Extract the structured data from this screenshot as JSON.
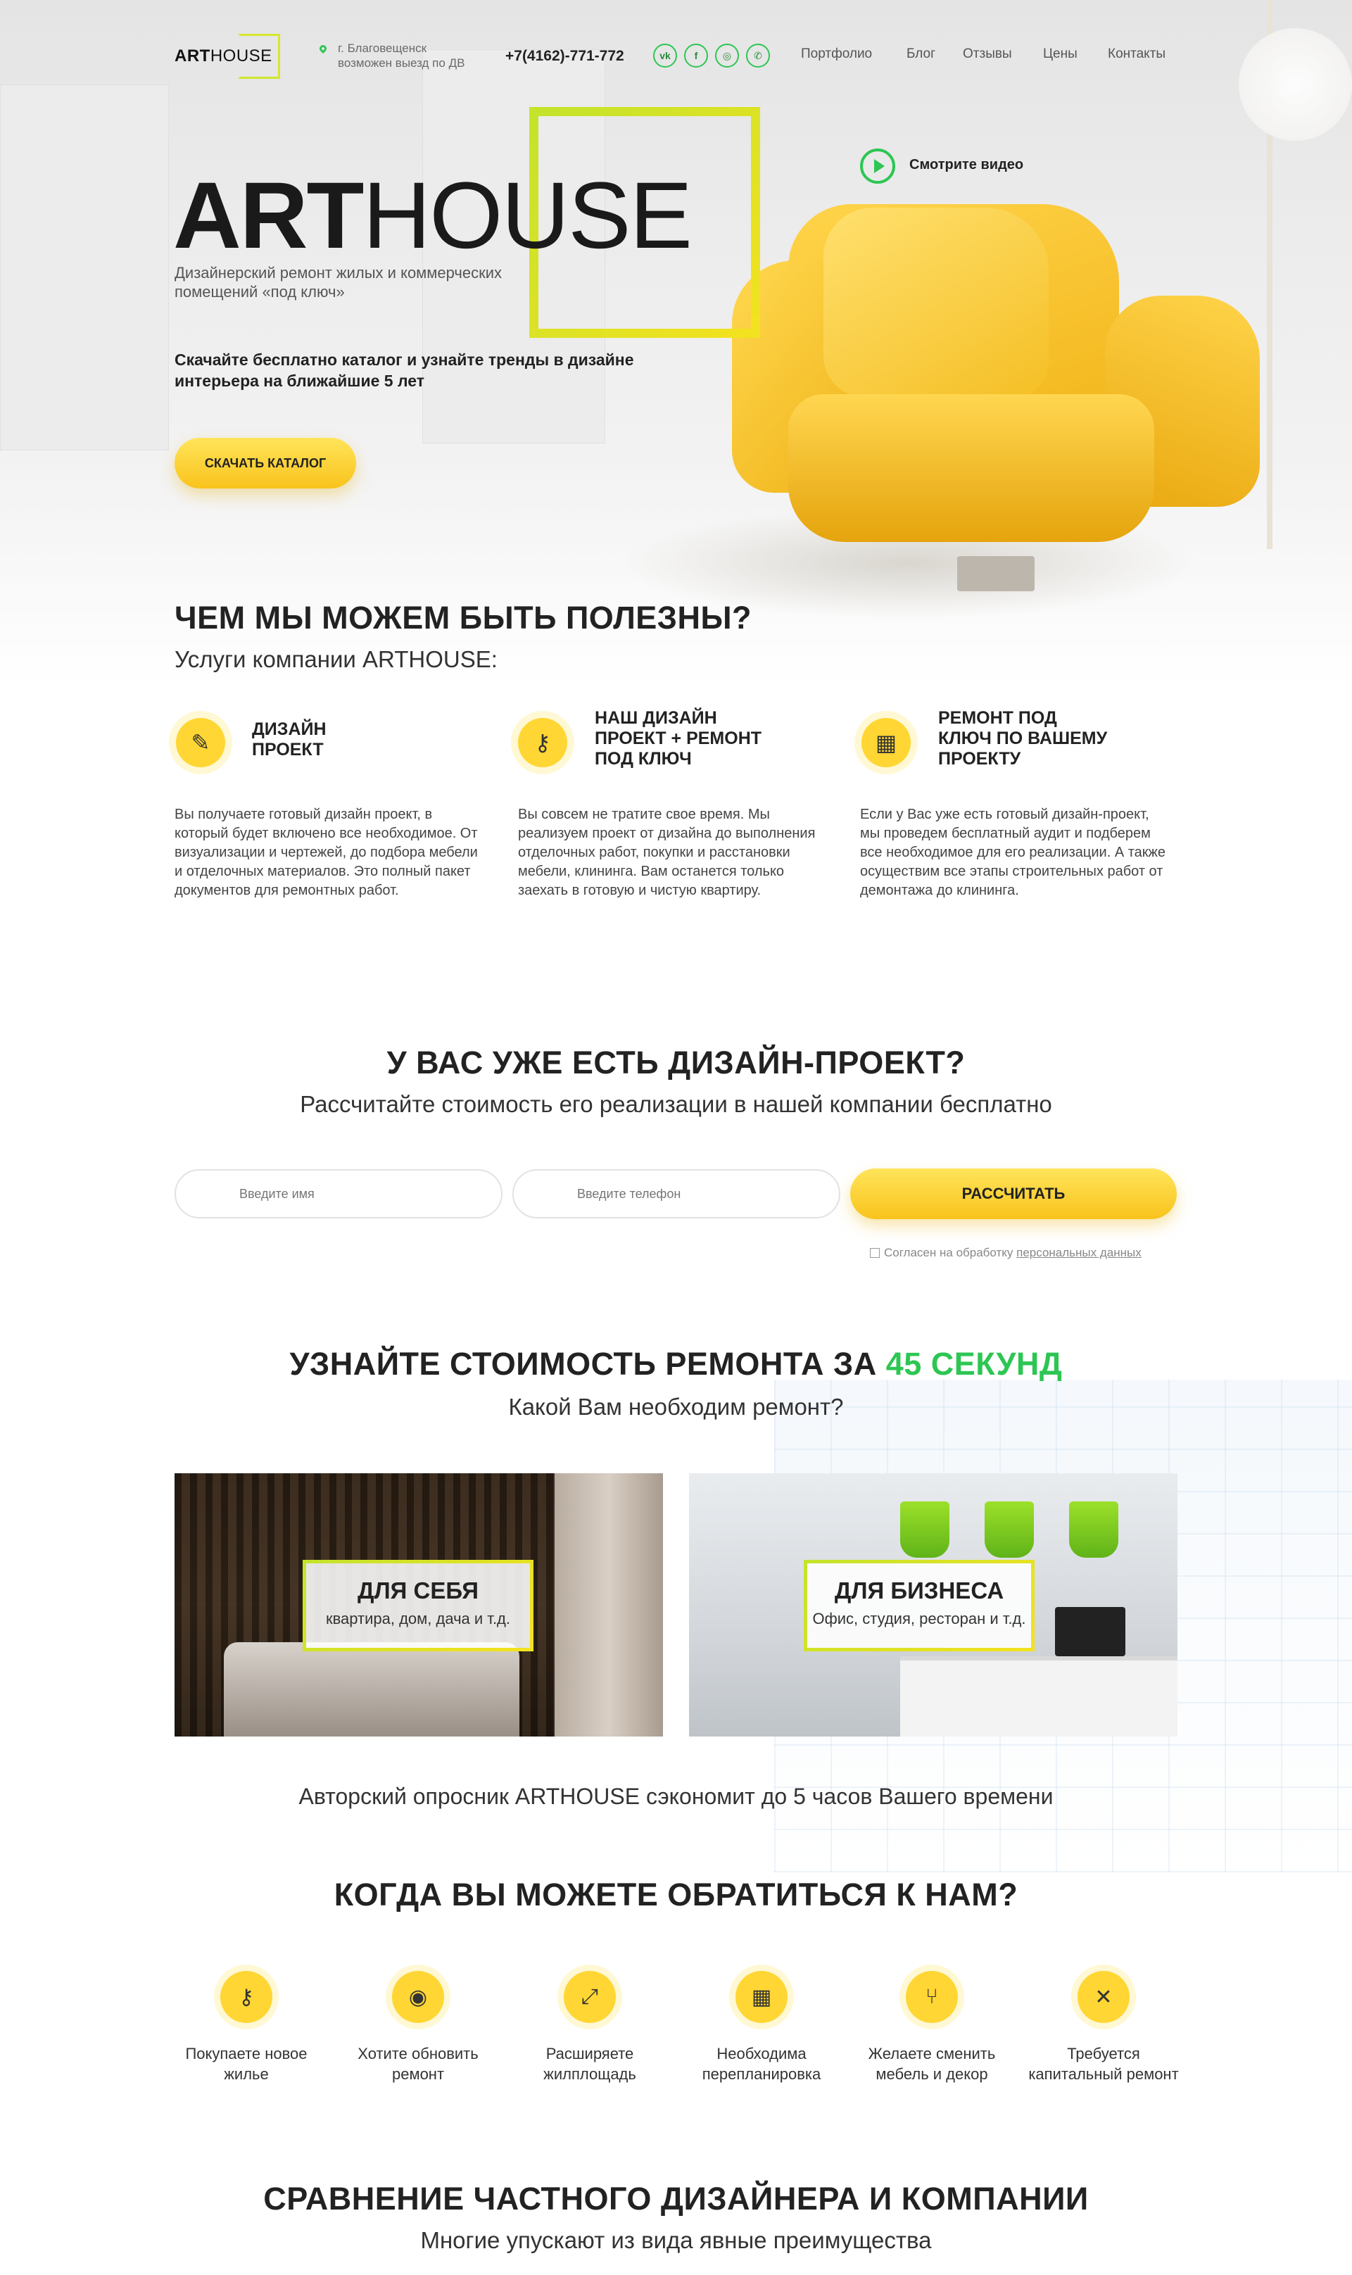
{
  "header": {
    "logo_bold": "ART",
    "logo_light": "HOUSE",
    "city_line1": "г. Благовещенск",
    "city_line2": "возможен выезд по ДВ",
    "phone": "+7(4162)-771-772",
    "social": [
      {
        "icon": "vk-icon",
        "glyph": "vk"
      },
      {
        "icon": "facebook-icon",
        "glyph": "f"
      },
      {
        "icon": "instagram-icon",
        "glyph": "◎"
      },
      {
        "icon": "whatsapp-icon",
        "glyph": "✆"
      }
    ],
    "nav": [
      "Портфолио",
      "Блог",
      "Отзывы",
      "Цены",
      "Контакты"
    ]
  },
  "hero": {
    "title_bold": "ART",
    "title_light": "HOUSE",
    "subtitle": "Дизайнерский ремонт жилых и коммерческих помещений «под ключ»",
    "description": "Скачайте бесплатно каталог и узнайте тренды в дизайне интерьера на ближайшие 5 лет",
    "button": "СКАЧАТЬ КАТАЛОГ",
    "video_label": "Смотрите видео"
  },
  "services": {
    "title": "ЧЕМ МЫ МОЖЕМ БЫТЬ ПОЛЕЗНЫ?",
    "subtitle": "Услуги компании ARTHOUSE:",
    "items": [
      {
        "icon": "design-tools-icon",
        "glyph": "✎",
        "title_lines": [
          "ДИЗАЙН",
          "ПРОЕКТ"
        ],
        "text": "Вы получаете готовый дизайн проект, в который будет включено все необходимое. От визуализации и чертежей, до подбора мебели и отделочных материалов. Это полный пакет документов для ремонтных работ."
      },
      {
        "icon": "key-icon",
        "glyph": "⚷",
        "title_lines": [
          "НАШ ДИЗАЙН",
          "ПРОЕКТ + РЕМОНТ",
          "ПОД КЛЮЧ"
        ],
        "text": "Вы совсем не тратите свое время. Мы реализуем проект от дизайна до выполнения отделочных работ, покупки и расстановки мебели, клининга. Вам останется только заехать в готовую и чистую квартиру."
      },
      {
        "icon": "floor-plan-icon",
        "glyph": "▦",
        "title_lines": [
          "РЕМОНТ ПОД",
          "КЛЮЧ ПО ВАШЕМУ",
          "ПРОЕКТУ"
        ],
        "text": "Если у Вас уже есть готовый дизайн-проект, мы проведем бесплатный аудит и подберем все необходимое для его реализации. А также осуществим все этапы строительных работ от демонтажа до клининга."
      }
    ]
  },
  "project_form": {
    "title": "У ВАС УЖЕ ЕСТЬ ДИЗАЙН-ПРОЕКТ?",
    "subtitle": "Рассчитайте стоимость его реализации в нашей компании бесплатно",
    "name_placeholder": "Введите имя",
    "phone_placeholder": "Введите телефон",
    "button": "РАССЧИТАТЬ",
    "agree_text": "Согласен на обработку",
    "agree_link": "персональных данных"
  },
  "quiz": {
    "title_main": "УЗНАЙТЕ СТОИМОСТЬ РЕМОНТА ЗА",
    "title_accent": "45 СЕКУНД",
    "subtitle": "Какой Вам необходим ремонт?",
    "cards": [
      {
        "title": "ДЛЯ СЕБЯ",
        "subtitle": "квартира, дом, дача и т.д."
      },
      {
        "title": "ДЛЯ БИЗНЕСА",
        "subtitle": "Офис, студия, ресторан и т.д."
      }
    ],
    "note": "Авторский опросник ARTHOUSE сэкономит до 5 часов Вашего времени"
  },
  "when": {
    "title": "КОГДА ВЫ МОЖЕТЕ ОБРАТИТЬСЯ К НАМ?",
    "items": [
      {
        "icon": "key-icon",
        "glyph": "⚷",
        "label": "Покупаете новое жилье"
      },
      {
        "icon": "paint-roll-icon",
        "glyph": "◉",
        "label": "Хотите обновить ремонт"
      },
      {
        "icon": "expand-arrows-icon",
        "glyph": "⤢",
        "label": "Расширяете жилплощадь"
      },
      {
        "icon": "floor-plan-icon",
        "glyph": "▦",
        "label": "Необходима перепланировка"
      },
      {
        "icon": "armchair-icon",
        "glyph": "⑂",
        "label": "Желаете сменить мебель и декор"
      },
      {
        "icon": "tools-icon",
        "glyph": "✕",
        "label": "Требуется капитальный ремонт"
      }
    ]
  },
  "compare": {
    "title": "СРАВНЕНИЕ ЧАСТНОГО ДИЗАЙНЕРА И КОМПАНИИ",
    "subtitle": "Многие упускают из вида явные преимущества"
  },
  "colors": {
    "accent_yellow": "#ffd633",
    "accent_green": "#2dc653",
    "frame_gradient": [
      "#c4e32b",
      "#f3e21f"
    ]
  }
}
